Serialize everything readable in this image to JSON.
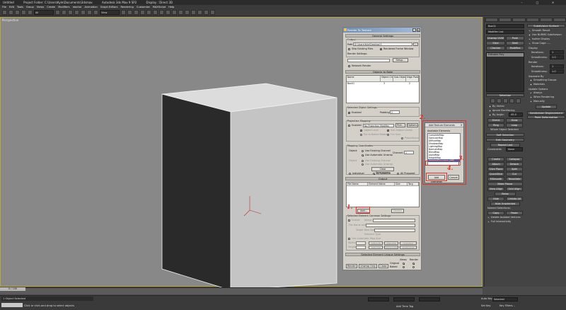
{
  "app": {
    "title_parts": [
      "Untitled",
      "Project Folder: C:\\Users\\Kyle\\Documents\\3dsmax",
      "Autodesk 3ds Max 9 SP2",
      "Display : Direct 3D"
    ],
    "menu": [
      "File",
      "Edit",
      "Tools",
      "Group",
      "Views",
      "Create",
      "Modifiers",
      "reactor",
      "Animation",
      "Graph Editors",
      "Rendering",
      "Customize",
      "MAXScript",
      "Help"
    ],
    "toolbar_select": "All",
    "toolbar_view": "View",
    "viewport_label": "Perspective"
  },
  "command_panel": {
    "object_name": "Box01",
    "modifier_list": "Modifier List",
    "buttons_top": [
      "Unwrap UVW",
      "Push",
      "Slice",
      "Shell",
      "Checker",
      "MultiRes"
    ],
    "stack": [
      "Editable Poly"
    ],
    "rollouts": [
      "Selection",
      "Soft Selection",
      "Edit Geometry",
      "Subdivision Surface"
    ],
    "edit_geometry": {
      "repeat_last": "Repeat Last",
      "constraints_label": "Constraints",
      "constraints_value": "None",
      "buttons": [
        "Create",
        "Collapse",
        "Attach",
        "Detach",
        "Slice Plane",
        "Split",
        "QuickSlice",
        "Cut",
        "MSmooth",
        "Tessellate",
        "Make Planar",
        "View Align",
        "Grid Align",
        "Relax",
        "Hide Selected",
        "Unhide All",
        "Hide Unselected"
      ],
      "named_selections": "Named Selections:",
      "copy": "Copy",
      "paste": "Paste",
      "delete_isolated": "Delete Isolated Vertices",
      "full_interactivity": "Full Interactivity"
    },
    "subdivision": {
      "title": "Subdivision Surface",
      "smooth_result": "Smooth Result",
      "use_nurms": "Use NURMS Subdivision",
      "isoline_display": "Isoline Display",
      "show_cage": "Show Cage......",
      "display_label": "Display",
      "iterations_label": "Iterations:",
      "iterations_value": "1",
      "smoothness_label": "Smoothness:",
      "smoothness_value": "1.0",
      "render_label": "Render",
      "separate_by": "Separate By",
      "smoothing_groups": "Smoothing Groups",
      "materials": "Materials",
      "update_options": "Update Options",
      "always": "Always",
      "when_rendering": "When Rendering",
      "manually": "Manually",
      "update_btn": "Update"
    },
    "selection": {
      "title": "Selection",
      "by_vertex": "By Vertex",
      "ignore_backfacing": "Ignore Backfacing",
      "by_angle": "By Angle:",
      "by_angle_value": "45.0",
      "shrink": "Shrink",
      "grow": "Grow",
      "ring": "Ring",
      "loop": "Loop",
      "whole_object": "Whole Object Selected"
    },
    "bottom_rollouts": [
      "Subdivision Displacement",
      "Paint Deformation"
    ]
  },
  "rtt": {
    "title": "Render To Texture",
    "general_settings": "General Settings",
    "output_label": "Output",
    "path_label": "Path",
    "path_value": "D:\\Users\\Kyle\\Desktop\\3",
    "skip_existing": "Skip Existing Files",
    "rendered_frame_window": "Rendered Frame Window",
    "render_settings": "Render Settings:",
    "setup": "Setup...",
    "network_render": "Network Render",
    "objects_to_bake": "Objects to Bake",
    "columns": [
      "Name",
      "Object Channel",
      "Sub-Object Channel",
      "Edge Padding"
    ],
    "rows": [
      [
        "Box01",
        "3",
        "",
        "2"
      ]
    ],
    "selected_object_settings": "Selected Object Settings",
    "enabled": "Enabled",
    "padding_label": "Padding:",
    "padding_value": "2",
    "projection_mapping": "Projection Mapping",
    "proj_enabled": "Enabled",
    "no_projection_modifier": "No Projection Modifier",
    "pick": "Pick...",
    "options": "Options...",
    "object_level": "Object Level",
    "sub_object_levels": "Sub-Object Levels",
    "put_to_baked_material": "Put to Baked Material",
    "full_size": "Full Size",
    "proportional": "Proportional",
    "mapping_coordinates": "Mapping Coordinates",
    "object_label": "Object:",
    "use_existing_channel": "Use Existing Channel",
    "use_automatic_unwrap": "Use Automatic Unwrap",
    "channel_label": "Channel:",
    "channel_value": "1",
    "clear_unwrappers": "Clear Unwrappers",
    "individual": "Individual",
    "all_selected": "All Selected",
    "all_prepared": "All Prepared",
    "output_section": "Output",
    "output_columns": [
      "File Name",
      "Element Name",
      "Size",
      "Targ"
    ],
    "add_button": "Add...",
    "delete_button": "Delete",
    "selected_element_common": "Selected Element Common Settings",
    "elem_enabled": "Enable",
    "elem_name": "Name:",
    "file_name_type": "File Name and Type",
    "target_map_slot": "Target Map Slot:",
    "element_type": "Element Type",
    "use_auto_map_size": "Use Automatic Map Size",
    "width_label": "Width:",
    "height_label": "Height:",
    "size_presets": [
      "128x128",
      "256x256",
      "512x512",
      "768x768",
      "1024x1024",
      "2048x2048"
    ],
    "selected_element_unique": "Selected Element Unique Settings",
    "bottom_buttons": [
      "Render",
      "Unwrap Only",
      "Close"
    ],
    "views_label": "Views",
    "render_label": "Render",
    "original": "Original",
    "baked": "Baked"
  },
  "ate": {
    "title": "Add Texture Elements",
    "available_label": "Available Elements",
    "elements": [
      "CompleteMap",
      "SpecularMap",
      "DiffuseMap",
      "ShadowsMap",
      "LightingMap",
      "NormalsMap",
      "BlendMap",
      "AlphaMap",
      "HeightMap",
      "AmbientOcclusion (MR)"
    ],
    "selected_index": 9,
    "add_elements": "Add Elements",
    "cancel": "Cancel"
  },
  "annotations": [
    "1.",
    "2.",
    "3.",
    "4."
  ],
  "status": {
    "frame": "0 / 100",
    "message1": "1 Object Selected",
    "message2": "Click or click-and-drag to select objects",
    "auto_key": "Auto Key",
    "selected": "Selected",
    "set_key": "Set Key",
    "key_filters": "Key Filters...",
    "add_time_tag": "Add Time Tag"
  },
  "colors": {
    "annotation": "#e0302a",
    "viewport_bg": "#888888",
    "viewport_border": "#b8a63a",
    "selection_blue": "#3366cc"
  }
}
